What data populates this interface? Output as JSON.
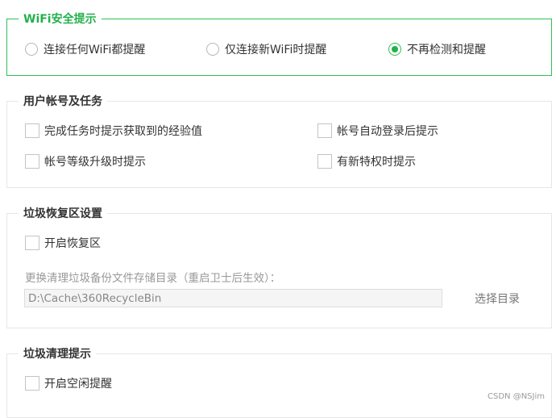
{
  "wifi": {
    "legend": "WiFi安全提示",
    "options": [
      "连接任何WiFi都提醒",
      "仅连接新WiFi时提醒",
      "不再检测和提醒"
    ],
    "selected_index": 2
  },
  "user_tasks": {
    "legend": "用户帐号及任务",
    "items": [
      {
        "label": "完成任务时提示获取到的经验值",
        "checked": false
      },
      {
        "label": "帐号自动登录后提示",
        "checked": false
      },
      {
        "label": "帐号等级升级时提示",
        "checked": false
      },
      {
        "label": "有新特权时提示",
        "checked": false
      }
    ]
  },
  "trash_recovery": {
    "legend": "垃圾恢复区设置",
    "enable_label": "开启恢复区",
    "enable_checked": false,
    "path_hint": "更换清理垃圾备份文件存储目录（重启卫士后生效）：",
    "path_value": "D:\\Cache\\360RecycleBin",
    "choose_label": "选择目录"
  },
  "trash_clean": {
    "legend": "垃圾清理提示",
    "idle_label": "开启空闲提醒",
    "idle_checked": false
  },
  "watermark": "CSDN @NSJim",
  "colors": {
    "accent": "#22b14c",
    "border": "#e6e6e6"
  }
}
